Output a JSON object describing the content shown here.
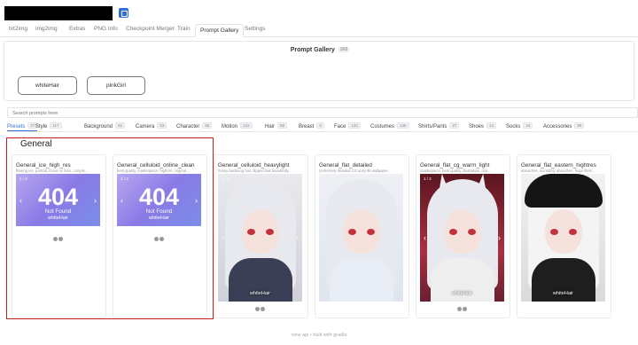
{
  "header": {
    "icon": "window-icon"
  },
  "tabs": [
    "txt2img",
    "img2img",
    "Extras",
    "PNG Info",
    "Checkpoint Merger",
    "Train",
    "Prompt Gallery",
    "Settings"
  ],
  "active_tab": "Prompt Gallery",
  "gallery": {
    "title": "Prompt Gallery",
    "count": "968",
    "chips": [
      "whiteHair",
      "pinkGirl"
    ],
    "search_placeholder": "Search prompts here"
  },
  "categories": [
    {
      "label": "Presets",
      "count": "27"
    },
    {
      "label": "Style",
      "count": "117"
    },
    {
      "label": "Background",
      "count": "81"
    },
    {
      "label": "Camera",
      "count": "63"
    },
    {
      "label": "Character",
      "count": "65"
    },
    {
      "label": "Motion",
      "count": "122"
    },
    {
      "label": "Hair",
      "count": "58"
    },
    {
      "label": "Breast",
      "count": "8"
    },
    {
      "label": "Face",
      "count": "132"
    },
    {
      "label": "Costumes",
      "count": "135"
    },
    {
      "label": "Shirts/Pants",
      "count": "27"
    },
    {
      "label": "Shoes",
      "count": "14"
    },
    {
      "label": "Socks",
      "count": "18"
    },
    {
      "label": "Accessories",
      "count": "96"
    }
  ],
  "group": {
    "title": "General"
  },
  "cards": [
    {
      "title": "General_ice_high_res",
      "subtitle": "flowing ice, portrait, focus on face, comple...",
      "pager": "1 / 2",
      "error_code": "404",
      "error_text": "Not Found",
      "caption": "whiteHair"
    },
    {
      "title": "General_celluloid_online_clean",
      "subtitle": "best quality, masterpiece, highres, original...",
      "pager": "1 / 2",
      "error_code": "404",
      "error_text": "Not Found",
      "caption": "whiteHair"
    },
    {
      "title": "General_celluloid_heavylight",
      "subtitle": "heavy backlong hair, flipped hair,beautifully...",
      "pager": "1 / 2",
      "caption": "whiteHair"
    },
    {
      "title": "General_flat_detailed",
      "subtitle": "(extremely detailed CG unity 8k wallpaper...",
      "pager": "",
      "caption": ""
    },
    {
      "title": "General_flat_cg_warm_light",
      "subtitle": "masterpiece, best quality, illustration, rice...",
      "pager": "1 / 2",
      "caption": "whiteHair"
    },
    {
      "title": "General_flat_eastern_hightres",
      "subtitle": "absurdres, incredibly absurdres, huge filesi...",
      "pager": "",
      "caption": "whiteHair"
    }
  ],
  "nav": {
    "prev": "‹",
    "next": "›"
  },
  "footer": "view api • built with gradio"
}
